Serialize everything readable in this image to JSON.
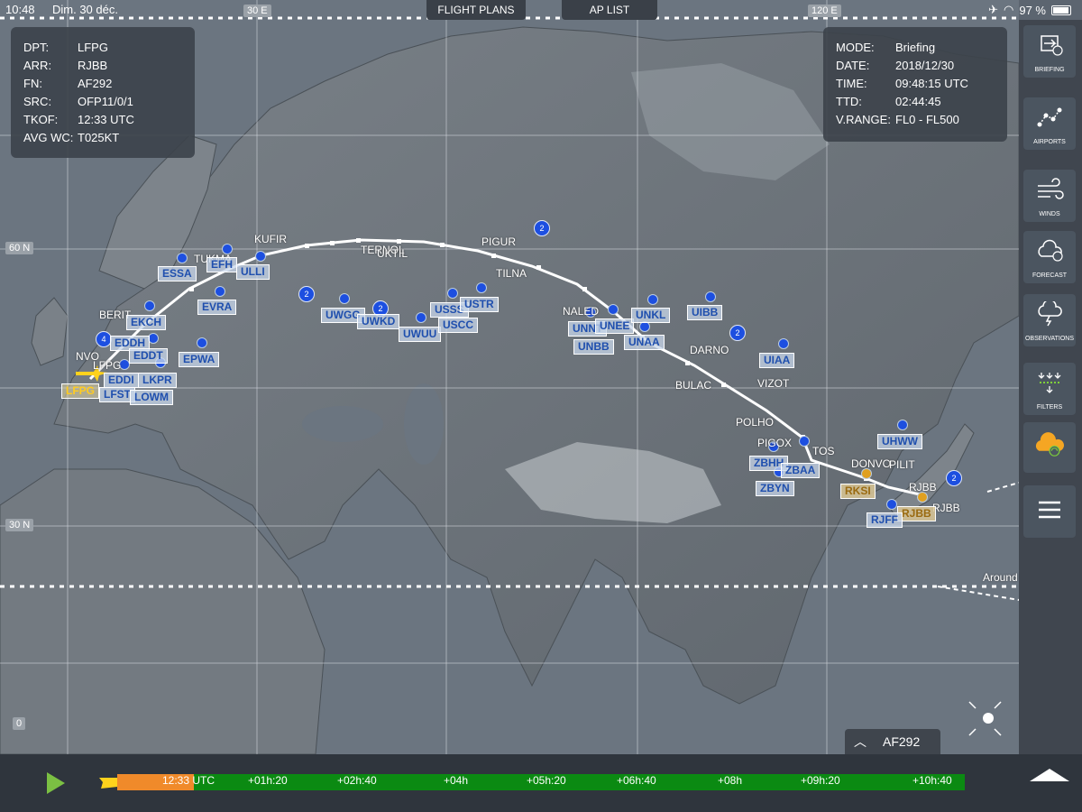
{
  "status": {
    "time": "10:48",
    "date": "Dim. 30 déc.",
    "battery": "97 %"
  },
  "top_tabs": {
    "flight_plans": "FLIGHT PLANS",
    "ap_list": "AP LIST"
  },
  "flight_info": {
    "rows": [
      {
        "label": "DPT:",
        "value": "LFPG"
      },
      {
        "label": "ARR:",
        "value": "RJBB"
      },
      {
        "label": "FN:",
        "value": "AF292"
      },
      {
        "label": "SRC:",
        "value": "OFP11/0/1"
      },
      {
        "label": "TKOF:",
        "value": "12:33 UTC"
      },
      {
        "label": "AVG WC:",
        "value": "T025KT"
      }
    ]
  },
  "mode_info": {
    "rows": [
      {
        "label": "MODE:",
        "value": "Briefing"
      },
      {
        "label": "DATE:",
        "value": "2018/12/30"
      },
      {
        "label": "TIME:",
        "value": "09:48:15 UTC"
      },
      {
        "label": "TTD:",
        "value": "02:44:45"
      },
      {
        "label": "V.RANGE:",
        "value": "FL0 - FL500"
      }
    ]
  },
  "grid_labels": {
    "lon_30e": "30 E",
    "lon_120e": "120 E",
    "lat_60n": "60 N",
    "lat_30n": "30 N",
    "lat_0": "0"
  },
  "waypoints": [
    "KUFIR",
    "TUKMA",
    "TERNOL",
    "UKTIL",
    "PIGUR",
    "TILNA",
    "BERIT",
    "NVO",
    "LFPG",
    "NALED",
    "DARNO",
    "BULAC",
    "VIZOT",
    "POLHO",
    "PIGOX",
    "TOS",
    "DONVO",
    "PILIT",
    "RJBB",
    "RJBB",
    "Around"
  ],
  "airports": [
    "ESSA",
    "EFH",
    "ULLI",
    "EVRA",
    "EKCH",
    "EDDH",
    "EDDT",
    "EPWA",
    "LKPR",
    "EDDI",
    "LFST",
    "LOWM",
    "LFPG",
    "UWGG",
    "UWKD",
    "UWUU",
    "USSS",
    "USCC",
    "USTR",
    "UNNT",
    "UNEE",
    "UNBB",
    "UNKL",
    "UNAA",
    "UIBB",
    "UIAA",
    "UHWW",
    "ZBHH",
    "ZBAA",
    "ZBYN",
    "RKSI",
    "RJBB",
    "RJFF"
  ],
  "clusters": [
    "2",
    "2",
    "2",
    "4",
    "2",
    "2"
  ],
  "sidebar": {
    "briefing": "BRIEFING",
    "airports": "AIRPORTS",
    "winds": "WINDS",
    "forecast": "FORECAST",
    "observations": "OBSERVATIONS",
    "filters": "FILTERS"
  },
  "flight_button": "AF292",
  "timeline": {
    "ticks": [
      "12:33 UTC",
      "+01h:20",
      "+02h:40",
      "+04h",
      "+05h:20",
      "+06h:40",
      "+08h",
      "+09h:20",
      "+10h:40"
    ],
    "elapsed_fraction": 0.09,
    "colors": {
      "elapsed": "#f08a2a",
      "remaining": "#0b8a12"
    }
  }
}
